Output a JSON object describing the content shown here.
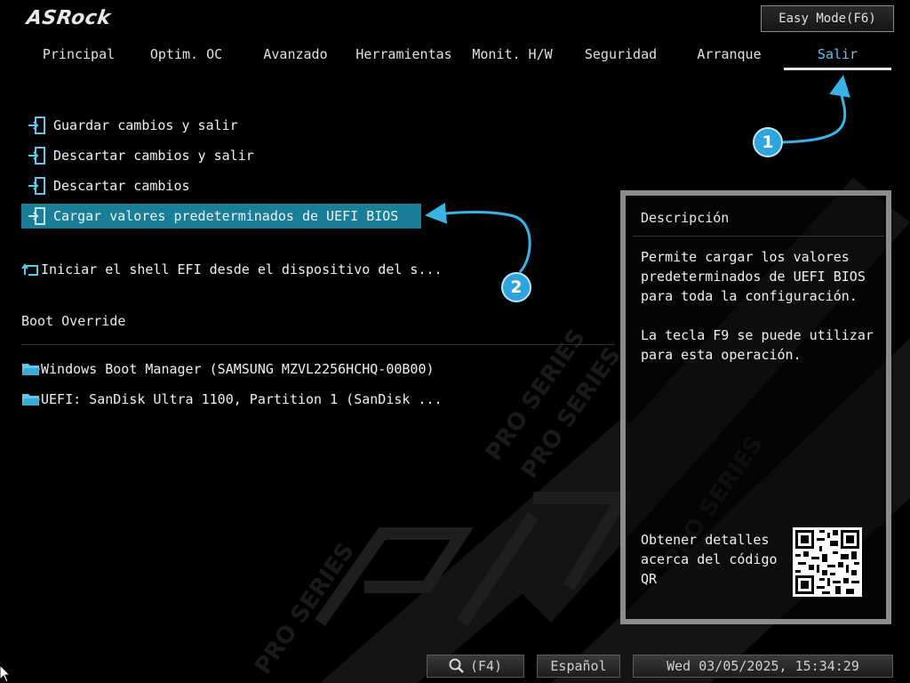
{
  "brand": {
    "logo_text": "ASRock"
  },
  "easy_mode": {
    "label": "Easy Mode(F6)"
  },
  "tabs": [
    {
      "label": "Principal",
      "active": false
    },
    {
      "label": "Optim. OC",
      "active": false
    },
    {
      "label": "Avanzado",
      "active": false
    },
    {
      "label": "Herramientas",
      "active": false
    },
    {
      "label": "Monit. H/W",
      "active": false
    },
    {
      "label": "Seguridad",
      "active": false
    },
    {
      "label": "Arranque",
      "active": false
    },
    {
      "label": "Salir",
      "active": true
    }
  ],
  "menu": {
    "items": [
      {
        "label": "Guardar cambios y salir",
        "icon": "exit-door-icon"
      },
      {
        "label": "Descartar cambios y salir",
        "icon": "exit-door-icon"
      },
      {
        "label": "Descartar cambios",
        "icon": "exit-door-icon"
      },
      {
        "label": "Cargar valores predeterminados de UEFI BIOS",
        "icon": "exit-door-icon",
        "selected": true
      },
      {
        "label": "Iniciar el shell EFI desde el dispositivo del s...",
        "icon": "shell-return-icon"
      }
    ],
    "boot_override": {
      "title": "Boot Override",
      "items": [
        {
          "label": "Windows Boot Manager (SAMSUNG MZVL2256HCHQ-00B00)",
          "icon": "folder-icon"
        },
        {
          "label": "UEFI: SanDisk Ultra 1100, Partition 1 (SanDisk ...",
          "icon": "folder-icon"
        }
      ]
    }
  },
  "description": {
    "title": "Descripción",
    "paragraphs": [
      "Permite cargar los valores predeterminados de UEFI BIOS para toda la configuración.",
      "La tecla F9 se puede utilizar para esta operación."
    ],
    "qr_label": "Obtener detalles acerca del código QR"
  },
  "callouts": {
    "one": "1",
    "two": "2"
  },
  "bottom": {
    "search_key": "(F4)",
    "language": "Español",
    "datetime": "Wed 03/05/2025, 15:34:29"
  },
  "colors": {
    "accent": "#5ec8ee",
    "selection": "#1b7d96",
    "callout": "#2fa3dc"
  }
}
